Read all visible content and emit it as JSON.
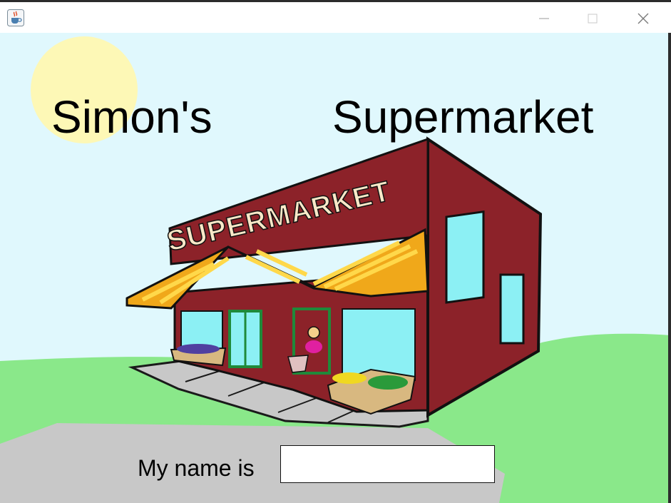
{
  "window": {
    "app_icon": "java-cup-icon",
    "controls": [
      "minimize-icon",
      "maximize-icon",
      "close-icon"
    ]
  },
  "scene": {
    "title_left": "Simon's",
    "title_right": "Supermarket",
    "store_sign": "SUPERMARKET",
    "colors": {
      "sky": "#e0f8fd",
      "sun": "#fdf8b6",
      "grass": "#8ae88a",
      "pavement": "#c8c8c8",
      "building": "#8c2229",
      "awning": "#f0a81a",
      "window": "#8cf0f4"
    }
  },
  "form": {
    "name_label": "My name is",
    "name_value": "",
    "name_placeholder": ""
  }
}
